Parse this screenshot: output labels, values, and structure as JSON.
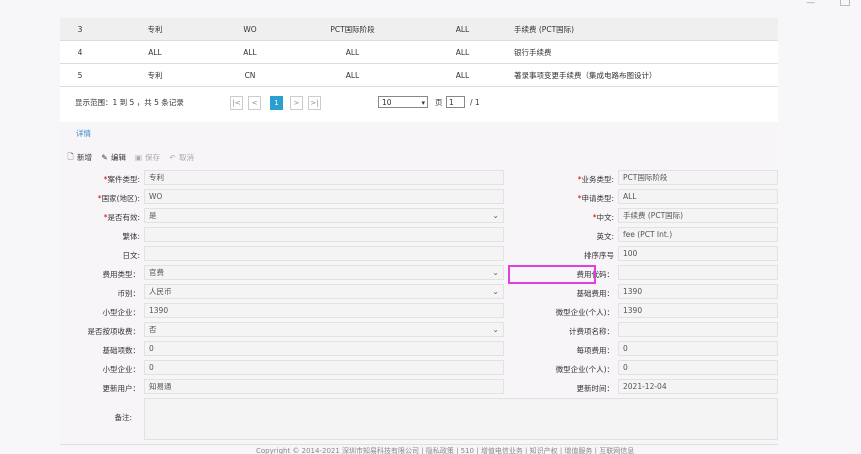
{
  "table": {
    "rows": [
      {
        "no": "3",
        "type": "专利",
        "country": "WO",
        "stage": "PCT国际阶段",
        "apply": "ALL",
        "name": "手续费 (PCT国际)"
      },
      {
        "no": "4",
        "type": "ALL",
        "country": "ALL",
        "stage": "ALL",
        "apply": "ALL",
        "name": "银行手续费"
      },
      {
        "no": "5",
        "type": "专利",
        "country": "CN",
        "stage": "ALL",
        "apply": "ALL",
        "name": "著录事项变更手续费（集成电路布图设计）"
      }
    ]
  },
  "pager": {
    "info": "显示范围：1 到 5 ，共 5 条记录",
    "first": "|<",
    "prev": "<",
    "current": "1",
    "next": ">",
    "last": ">|",
    "page_size": "10",
    "page_label": "页",
    "page_input": "1",
    "total": "/ 1"
  },
  "detail": {
    "tab": "详情",
    "toolbar": {
      "add": "新增",
      "edit": "编辑",
      "save": "保存",
      "cancel": "取消"
    },
    "fields": {
      "case_type": {
        "label": "案件类型:",
        "value": "专利"
      },
      "biz_type": {
        "label": "业务类型:",
        "value": "PCT国际阶段"
      },
      "country": {
        "label": "国家(地区):",
        "value": "WO"
      },
      "apply_type": {
        "label": "申请类型:",
        "value": "ALL"
      },
      "valid": {
        "label": "是否有效:",
        "value": "是"
      },
      "cn_name": {
        "label": "中文:",
        "value": "手续费 (PCT国际)"
      },
      "trad": {
        "label": "繁体:",
        "value": ""
      },
      "en_name": {
        "label": "英文:",
        "value": "fee (PCT Int.)"
      },
      "jp": {
        "label": "日文:",
        "value": ""
      },
      "sort": {
        "label": "排序序号",
        "value": "100"
      },
      "fee_type": {
        "label": "费用类型：",
        "value": "官费"
      },
      "fee_code": {
        "label": "费用代码：",
        "value": ""
      },
      "currency": {
        "label": "币别：",
        "value": "人民币"
      },
      "base_fee": {
        "label": "基础费用：",
        "value": "1390"
      },
      "small_ent": {
        "label": "小型企业：",
        "value": "1390"
      },
      "micro_ent": {
        "label": "微型企业(个人)：",
        "value": "1390"
      },
      "by_item": {
        "label": "是否按项收费：",
        "value": "否"
      },
      "unit_name": {
        "label": "计费项名称：",
        "value": ""
      },
      "base_items": {
        "label": "基础项数：",
        "value": "0"
      },
      "per_item": {
        "label": "每项费用：",
        "value": "0"
      },
      "small_ent2": {
        "label": "小型企业：",
        "value": "0"
      },
      "micro_ent2": {
        "label": "微型企业(个人)：",
        "value": "0"
      },
      "updater": {
        "label": "更新用户：",
        "value": "知易通"
      },
      "update_time": {
        "label": "更新时间：",
        "value": "2021-12-04"
      },
      "remark": {
        "label": "备注:",
        "value": ""
      }
    }
  },
  "footer": {
    "text": "Copyright © 2014-2021 深圳市知易科技有限公司 | 隐私政策 | 510 | 增值电信业务 | 知识产权 | 增值服务 | 互联网信息"
  }
}
